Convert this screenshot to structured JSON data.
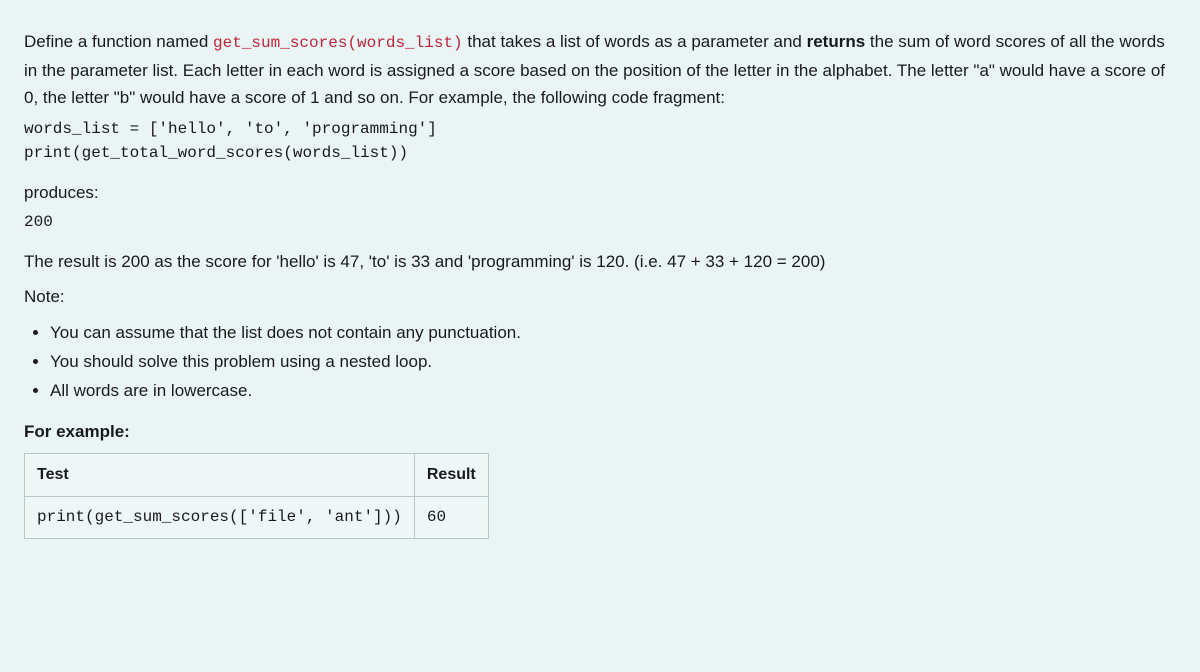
{
  "intro": {
    "prefix": "Define a function named ",
    "func": "get_sum_scores(words_list)",
    "mid1": " that takes a list of words as a parameter and ",
    "returns": "returns",
    "mid2": " the sum of word scores of all the words in the parameter list. Each letter in each word is assigned a score based on the position of the letter in the alphabet. The letter \"a\" would have a score of 0, the letter \"b\" would have a score of 1 and so on. For example, the following code fragment:"
  },
  "code1": "words_list = ['hello', 'to', 'programming']\nprint(get_total_word_scores(words_list))",
  "produces_label": "produces:",
  "output1": "200",
  "explain": "The result is 200 as the score for 'hello' is 47, 'to' is 33 and 'programming' is 120. (i.e. 47 + 33 + 120 = 200)",
  "note_label": "Note:",
  "notes": [
    "You can assume that the list does not contain any punctuation.",
    "You should solve this problem using a nested loop.",
    "All words are in lowercase."
  ],
  "for_example": "For example:",
  "table": {
    "headers": [
      "Test",
      "Result"
    ],
    "rows": [
      {
        "test": "print(get_sum_scores(['file', 'ant']))",
        "result": "60"
      }
    ]
  }
}
